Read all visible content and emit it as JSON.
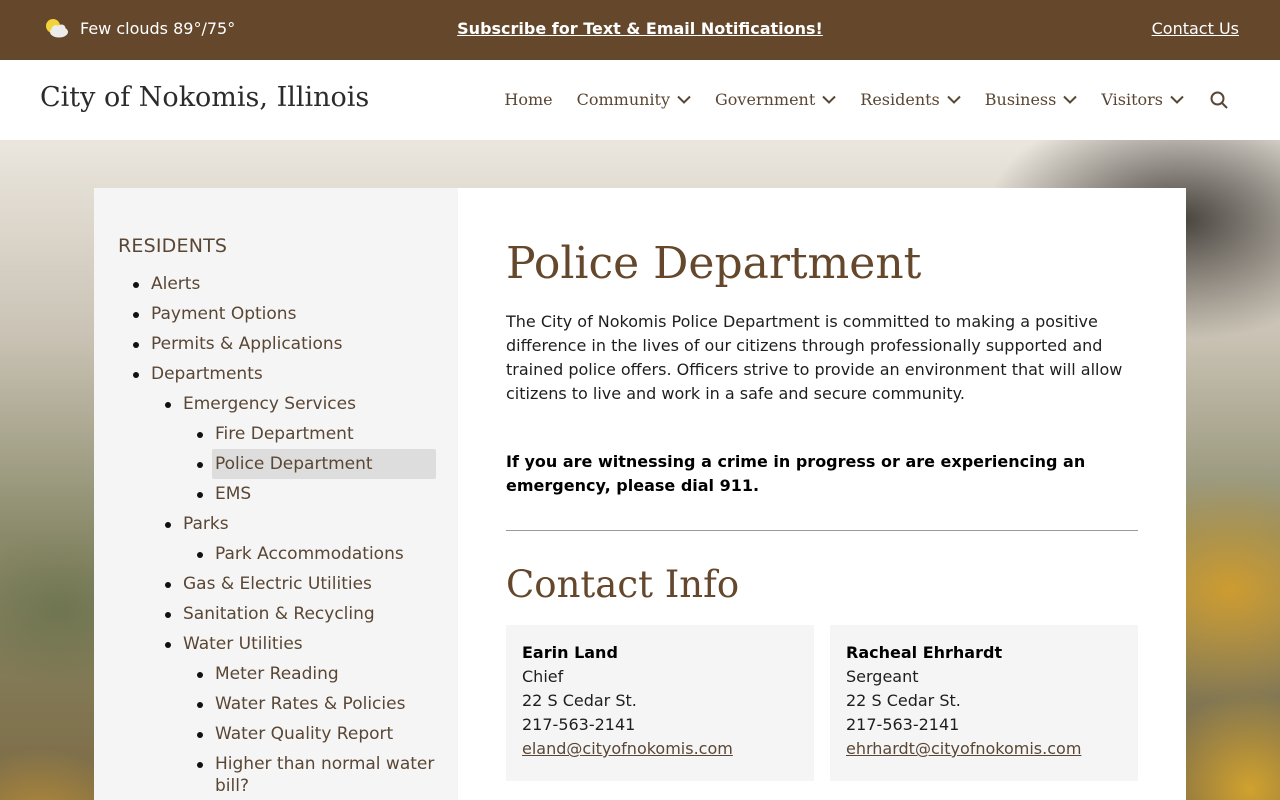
{
  "topbar": {
    "weather_text": "Few clouds 89°/75°",
    "subscribe_label": "Subscribe for Text & Email Notifications!",
    "contact_label": "Contact Us"
  },
  "header": {
    "site_title": "City of Nokomis, Illinois",
    "nav": [
      {
        "label": "Home"
      },
      {
        "label": "Community"
      },
      {
        "label": "Government"
      },
      {
        "label": "Residents"
      },
      {
        "label": "Business"
      },
      {
        "label": "Visitors"
      }
    ]
  },
  "sidebar": {
    "title": "RESIDENTS",
    "items": [
      {
        "label": "Alerts"
      },
      {
        "label": "Payment Options"
      },
      {
        "label": "Permits & Applications"
      },
      {
        "label": "Departments"
      },
      {
        "label": "Emergency Services"
      },
      {
        "label": "Fire Department"
      },
      {
        "label": "Police Department"
      },
      {
        "label": "EMS"
      },
      {
        "label": "Parks"
      },
      {
        "label": "Park Accommodations"
      },
      {
        "label": "Gas & Electric Utilities"
      },
      {
        "label": "Sanitation & Recycling"
      },
      {
        "label": "Water Utilities"
      },
      {
        "label": "Meter Reading"
      },
      {
        "label": "Water Rates & Policies"
      },
      {
        "label": "Water Quality Report"
      },
      {
        "label": "Higher than normal water bill?"
      }
    ]
  },
  "main": {
    "title": "Police Department",
    "intro": "The City of Nokomis Police Department is committed to making a positive difference in the lives of our citizens through professionally supported and trained police offers. Officers strive to provide an environment that will allow citizens to live and work in a safe and secure community.",
    "alert": "If you are witnessing a crime in progress or are experiencing an emergency, please dial 911.",
    "contact_heading": "Contact Info",
    "contacts": [
      {
        "name": "Earin Land",
        "role": "Chief",
        "address": "22 S Cedar St.",
        "phone": "217-563-2141",
        "email": "eland@cityofnokomis.com"
      },
      {
        "name": "Racheal Ehrhardt",
        "role": "Sergeant",
        "address": "22 S Cedar St.",
        "phone": "217-563-2141",
        "email": "ehrhardt@cityofnokomis.com"
      }
    ]
  },
  "colors": {
    "brand_brown": "#65472c",
    "link_brown": "#5a4634",
    "panel_gray": "#f5f5f5",
    "active_gray": "#dddddd"
  },
  "icons": {
    "weather": "partly-cloudy-icon",
    "dropdown": "chevron-down-icon",
    "search": "search-icon"
  }
}
